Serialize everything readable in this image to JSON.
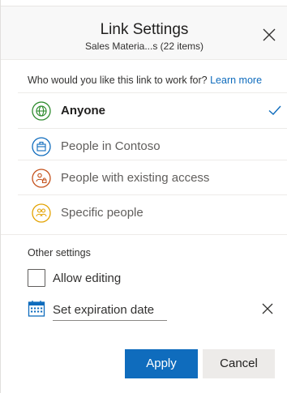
{
  "dialog": {
    "title": "Link Settings",
    "subtitle": "Sales Materia...s (22 items)"
  },
  "audience": {
    "question": "Who would you like this link to work for?",
    "learn_more": "Learn more",
    "options": [
      {
        "label": "Anyone",
        "icon": "globe-icon",
        "color": "#2e8b2e",
        "selected": true
      },
      {
        "label": "People in Contoso",
        "icon": "organization-icon",
        "color": "#0f6cbd",
        "selected": false
      },
      {
        "label": "People with existing access",
        "icon": "people-lock-icon",
        "color": "#c4501a",
        "selected": false
      },
      {
        "label": "Specific people",
        "icon": "people-icon",
        "color": "#e3a200",
        "selected": false
      }
    ]
  },
  "other_settings": {
    "heading": "Other settings",
    "allow_editing": "Allow editing",
    "allow_editing_checked": false,
    "expiration_label": "Set expiration date"
  },
  "buttons": {
    "apply": "Apply",
    "cancel": "Cancel"
  },
  "colors": {
    "accent": "#0f6cbd",
    "check": "#0f6cbd"
  }
}
